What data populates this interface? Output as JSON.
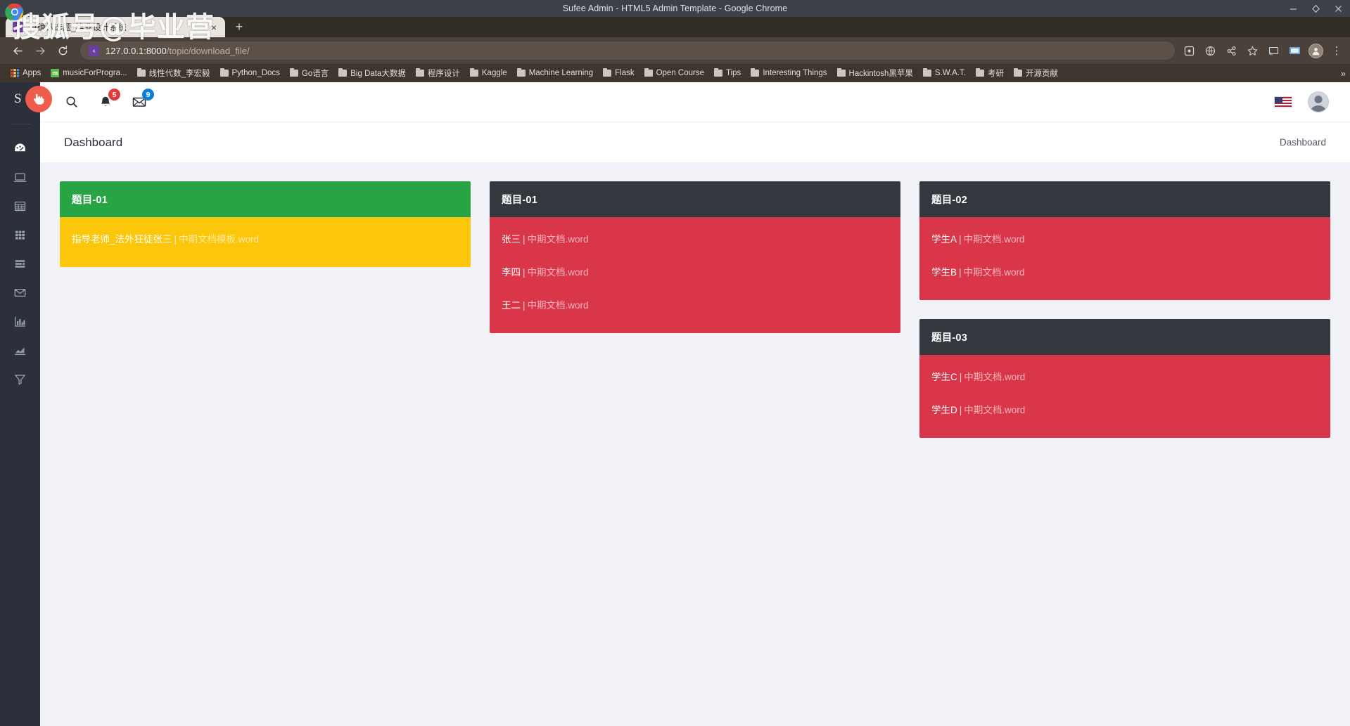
{
  "browser": {
    "window_title": "Sufee Admin - HTML5 Admin Template - Google Chrome",
    "window_controls": [
      "minimize-icon",
      "maximize-icon",
      "close-icon"
    ],
    "tab": {
      "title": "待确认选题_毕业设计系统",
      "favicon": "django-favicon",
      "close_label": "×"
    },
    "new_tab_label": "+",
    "nav": {
      "back": "←",
      "forward": "→",
      "reload": "⟳"
    },
    "omnibox": {
      "url_host": "127.0.0.1:8000",
      "url_path": "/topic/download_file/",
      "site_icon": "page-icon"
    },
    "toolbar_icons": [
      "extension-icon",
      "translate-icon",
      "share-icon",
      "bookmark-star-icon",
      "chromecast-icon",
      "screen-icon"
    ],
    "profile_initial": "",
    "menu": "⋮",
    "bookmarks": [
      {
        "label": "Apps",
        "icon": "apps-grid-icon"
      },
      {
        "label": "musicForProgra...",
        "icon": "music-icon"
      },
      {
        "label": "线性代数_李宏毅",
        "icon": "folder-icon"
      },
      {
        "label": "Python_Docs",
        "icon": "folder-icon"
      },
      {
        "label": "Go语言",
        "icon": "folder-icon"
      },
      {
        "label": "Big Data大数据",
        "icon": "folder-icon"
      },
      {
        "label": "程序设计",
        "icon": "folder-icon"
      },
      {
        "label": "Kaggle",
        "icon": "folder-icon"
      },
      {
        "label": "Machine Learning",
        "icon": "folder-icon"
      },
      {
        "label": "Flask",
        "icon": "folder-icon"
      },
      {
        "label": "Open Course",
        "icon": "folder-icon"
      },
      {
        "label": "Tips",
        "icon": "folder-icon"
      },
      {
        "label": "Interesting Things",
        "icon": "folder-icon"
      },
      {
        "label": "Hackintosh黑苹果",
        "icon": "folder-icon"
      },
      {
        "label": "S.W.A.T.",
        "icon": "folder-icon"
      },
      {
        "label": "考研",
        "icon": "folder-icon"
      },
      {
        "label": "开源贡献",
        "icon": "folder-icon"
      }
    ],
    "bookmarks_overflow": "»"
  },
  "watermark": {
    "text": "搜狐号@毕业营"
  },
  "sidebar": {
    "logo": "S",
    "items": [
      {
        "name": "dashboard",
        "icon": "speedometer-icon",
        "active": true
      },
      {
        "name": "ui-elements",
        "icon": "laptop-icon",
        "active": false
      },
      {
        "name": "tables",
        "icon": "table-grid-icon",
        "active": false
      },
      {
        "name": "apps",
        "icon": "apps-grid-icon",
        "active": false
      },
      {
        "name": "forms",
        "icon": "forms-list-icon",
        "active": false
      },
      {
        "name": "mailbox",
        "icon": "envelope-icon",
        "active": false
      },
      {
        "name": "charts",
        "icon": "bar-chart-icon",
        "active": false
      },
      {
        "name": "analytics",
        "icon": "area-chart-icon",
        "active": false
      },
      {
        "name": "filters",
        "icon": "funnel-icon",
        "active": false
      }
    ]
  },
  "topbar": {
    "search_icon": "search-icon",
    "notifications": {
      "icon": "bell-icon",
      "count": "5",
      "color": "#e3393c"
    },
    "messages": {
      "icon": "envelope-icon",
      "count": "9",
      "color": "#0f80d8"
    },
    "language_flag": "us-flag-icon",
    "avatar": "user-avatar",
    "cursor_indicator": "pointer-cursor-icon"
  },
  "page": {
    "title": "Dashboard",
    "breadcrumb": "Dashboard"
  },
  "cards": {
    "column1": [
      {
        "header": "题目-01",
        "header_color": "#27a444",
        "body_color": "#fcc60a",
        "rows": [
          {
            "person": "指导老师_法外狂徒张三",
            "file": "中期文档模板.word"
          }
        ]
      }
    ],
    "column2": [
      {
        "header": "题目-01",
        "header_color": "#32383e",
        "body_color": "#d9364a",
        "rows": [
          {
            "person": "张三",
            "file": "中期文档.word"
          },
          {
            "person": "李四",
            "file": "中期文档.word"
          },
          {
            "person": "王二",
            "file": "中期文档.word"
          }
        ]
      }
    ],
    "column3": [
      {
        "header": "题目-02",
        "header_color": "#32383e",
        "body_color": "#d9364a",
        "rows": [
          {
            "person": "学生A",
            "file": "中期文档.word"
          },
          {
            "person": "学生B",
            "file": "中期文档.word"
          }
        ]
      },
      {
        "header": "题目-03",
        "header_color": "#32383e",
        "body_color": "#d9364a",
        "rows": [
          {
            "person": "学生C",
            "file": "中期文档.word"
          },
          {
            "person": "学生D",
            "file": "中期文档.word"
          }
        ]
      }
    ]
  },
  "separator": "|"
}
